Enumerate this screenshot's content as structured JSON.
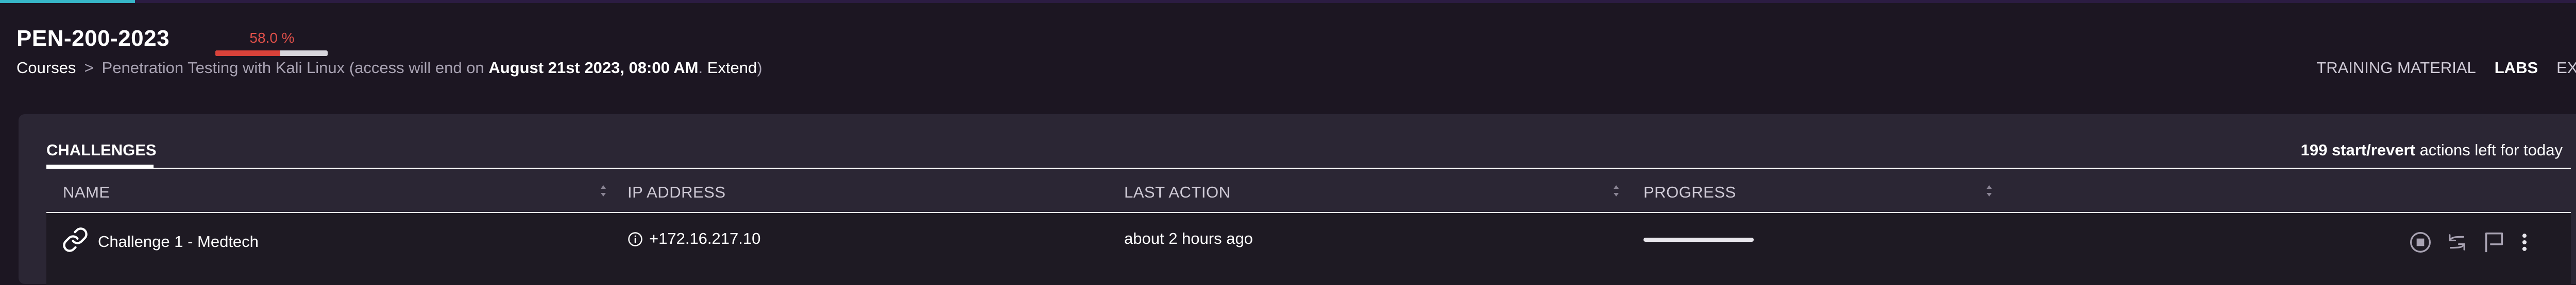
{
  "header": {
    "course_code": "PEN-200-2023",
    "progress_label": "58.0 %",
    "progress_fraction": 0.58
  },
  "breadcrumb": {
    "root": "Courses",
    "separator": ">",
    "course_name": "Penetration Testing with Kali Linux",
    "access_prefix": "(access will end on",
    "access_date": "August 21st 2023, 08:00 AM",
    "after_date": ".",
    "extend_label": "Extend",
    "close_paren": ")"
  },
  "top_nav": {
    "items": [
      {
        "label": "TRAINING MATERIAL",
        "active": false
      },
      {
        "label": "LABS",
        "active": true
      },
      {
        "label": "EXAM",
        "active": false
      }
    ]
  },
  "panel": {
    "tab_label": "CHALLENGES",
    "actions_count": "199 start/revert",
    "actions_suffix": "actions left for today"
  },
  "table": {
    "columns": [
      "NAME",
      "IP ADDRESS",
      "LAST ACTION",
      "PROGRESS"
    ],
    "rows": [
      {
        "name": "Challenge 1 - Medtech",
        "ip": "+172.16.217.10",
        "last_action": "about 2 hours ago",
        "progress_fraction": 1.0
      }
    ]
  },
  "icons": {
    "row_type": "link-icon",
    "ip_info": "info-icon",
    "row_actions": [
      "stop-icon",
      "revert-icon",
      "flag-icon",
      "more-icon"
    ]
  },
  "colors": {
    "background": "#1c1622",
    "panel": "#2b2634",
    "accent_cyan": "#37b6c8",
    "progress_red": "#d9423a",
    "progress_label_red": "#e0504a"
  }
}
